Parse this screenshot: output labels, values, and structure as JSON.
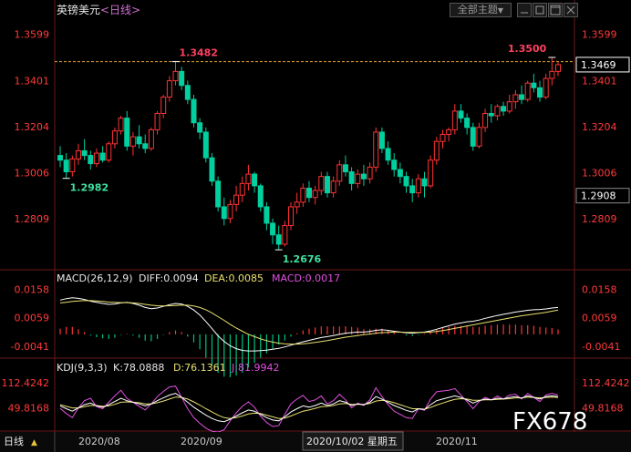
{
  "header": {
    "symbol": "英镑美元",
    "period": "<日线>",
    "topic_button": "全部主题",
    "topic_arrow": "▼"
  },
  "watermark": "FX678",
  "bottom_bar": {
    "period_label": "日线",
    "period_arrow": "▲",
    "dates": [
      "2020/08",
      "2020/09",
      "2020/10/02 星期五",
      "2020/11"
    ]
  },
  "chart_data": [
    {
      "type": "candlestick",
      "pane": "price",
      "y_ticks": [
        "1.3599",
        "1.3401",
        "1.3204",
        "1.3006",
        "1.2809"
      ],
      "ylim": [
        1.2614,
        1.366
      ],
      "current_price": "1.3469",
      "marker_price": "1.2908",
      "annotations": {
        "high1": "1.3482",
        "low1": "1.2982",
        "low2": "1.2676",
        "high2": "1.3500"
      },
      "reference_line": 1.3482,
      "ohlc": [
        [
          1.308,
          1.312,
          1.303,
          1.306
        ],
        [
          1.306,
          1.309,
          1.2982,
          1.301
        ],
        [
          1.301,
          1.308,
          1.299,
          1.3065
        ],
        [
          1.3065,
          1.313,
          1.304,
          1.31
        ],
        [
          1.31,
          1.315,
          1.306,
          1.308
        ],
        [
          1.308,
          1.31,
          1.302,
          1.3045
        ],
        [
          1.3045,
          1.311,
          1.303,
          1.309
        ],
        [
          1.309,
          1.312,
          1.305,
          1.306
        ],
        [
          1.306,
          1.314,
          1.305,
          1.313
        ],
        [
          1.313,
          1.32,
          1.311,
          1.3185
        ],
        [
          1.3185,
          1.325,
          1.317,
          1.324
        ],
        [
          1.324,
          1.327,
          1.31,
          1.312
        ],
        [
          1.312,
          1.318,
          1.308,
          1.316
        ],
        [
          1.316,
          1.321,
          1.311,
          1.313
        ],
        [
          1.313,
          1.317,
          1.309,
          1.311
        ],
        [
          1.311,
          1.32,
          1.31,
          1.319
        ],
        [
          1.319,
          1.327,
          1.317,
          1.326
        ],
        [
          1.326,
          1.334,
          1.324,
          1.333
        ],
        [
          1.333,
          1.342,
          1.331,
          1.34
        ],
        [
          1.34,
          1.3482,
          1.338,
          1.344
        ],
        [
          1.344,
          1.346,
          1.336,
          1.338
        ],
        [
          1.338,
          1.34,
          1.33,
          1.332
        ],
        [
          1.332,
          1.334,
          1.32,
          1.322
        ],
        [
          1.322,
          1.324,
          1.315,
          1.318
        ],
        [
          1.318,
          1.32,
          1.305,
          1.307
        ],
        [
          1.307,
          1.309,
          1.295,
          1.297
        ],
        [
          1.297,
          1.299,
          1.284,
          1.286
        ],
        [
          1.286,
          1.29,
          1.278,
          1.281
        ],
        [
          1.281,
          1.289,
          1.279,
          1.287
        ],
        [
          1.287,
          1.295,
          1.284,
          1.291
        ],
        [
          1.291,
          1.299,
          1.288,
          1.296
        ],
        [
          1.296,
          1.304,
          1.293,
          1.3
        ],
        [
          1.3,
          1.301,
          1.292,
          1.295
        ],
        [
          1.295,
          1.296,
          1.284,
          1.286
        ],
        [
          1.286,
          1.288,
          1.276,
          1.279
        ],
        [
          1.279,
          1.281,
          1.27,
          1.274
        ],
        [
          1.274,
          1.278,
          1.2676,
          1.27
        ],
        [
          1.27,
          1.28,
          1.269,
          1.278
        ],
        [
          1.278,
          1.288,
          1.276,
          1.286
        ],
        [
          1.286,
          1.292,
          1.283,
          1.288
        ],
        [
          1.288,
          1.296,
          1.286,
          1.294
        ],
        [
          1.294,
          1.297,
          1.288,
          1.29
        ],
        [
          1.29,
          1.295,
          1.287,
          1.293
        ],
        [
          1.293,
          1.301,
          1.291,
          1.299
        ],
        [
          1.299,
          1.301,
          1.29,
          1.292
        ],
        [
          1.292,
          1.299,
          1.29,
          1.297
        ],
        [
          1.297,
          1.306,
          1.295,
          1.304
        ],
        [
          1.304,
          1.308,
          1.299,
          1.301
        ],
        [
          1.301,
          1.303,
          1.293,
          1.296
        ],
        [
          1.296,
          1.302,
          1.294,
          1.3
        ],
        [
          1.3,
          1.304,
          1.295,
          1.298
        ],
        [
          1.298,
          1.305,
          1.296,
          1.303
        ],
        [
          1.303,
          1.32,
          1.301,
          1.318
        ],
        [
          1.318,
          1.32,
          1.309,
          1.311
        ],
        [
          1.311,
          1.314,
          1.304,
          1.306
        ],
        [
          1.306,
          1.309,
          1.299,
          1.302
        ],
        [
          1.302,
          1.305,
          1.296,
          1.299
        ],
        [
          1.299,
          1.301,
          1.292,
          1.295
        ],
        [
          1.295,
          1.298,
          1.288,
          1.292
        ],
        [
          1.292,
          1.3,
          1.29,
          1.298
        ],
        [
          1.298,
          1.301,
          1.29,
          1.295
        ],
        [
          1.295,
          1.308,
          1.294,
          1.306
        ],
        [
          1.306,
          1.316,
          1.304,
          1.314
        ],
        [
          1.314,
          1.319,
          1.311,
          1.317
        ],
        [
          1.317,
          1.32,
          1.314,
          1.319
        ],
        [
          1.319,
          1.33,
          1.317,
          1.327
        ],
        [
          1.327,
          1.33,
          1.322,
          1.324
        ],
        [
          1.324,
          1.326,
          1.317,
          1.32
        ],
        [
          1.32,
          1.322,
          1.31,
          1.312
        ],
        [
          1.312,
          1.322,
          1.311,
          1.32
        ],
        [
          1.32,
          1.328,
          1.318,
          1.326
        ],
        [
          1.326,
          1.33,
          1.322,
          1.325
        ],
        [
          1.325,
          1.33,
          1.323,
          1.329
        ],
        [
          1.329,
          1.331,
          1.325,
          1.327
        ],
        [
          1.327,
          1.334,
          1.326,
          1.331
        ],
        [
          1.331,
          1.336,
          1.328,
          1.334
        ],
        [
          1.334,
          1.338,
          1.33,
          1.332
        ],
        [
          1.332,
          1.34,
          1.331,
          1.339
        ],
        [
          1.339,
          1.343,
          1.335,
          1.337
        ],
        [
          1.337,
          1.34,
          1.331,
          1.333
        ],
        [
          1.333,
          1.343,
          1.332,
          1.341
        ],
        [
          1.341,
          1.35,
          1.338,
          1.344
        ],
        [
          1.344,
          1.348,
          1.342,
          1.3469
        ]
      ]
    },
    {
      "type": "macd",
      "pane": "macd",
      "label": "MACD(26,12,9)",
      "diff_label": "DIFF:0.0094",
      "dea_label": "DEA:0.0085",
      "macd_label": "MACD:0.0017",
      "y_ticks": [
        "0.0158",
        "0.0059",
        "-0.0041"
      ],
      "ylim": [
        -0.008,
        0.0175
      ],
      "diff": [
        0.012,
        0.0125,
        0.0128,
        0.0126,
        0.0122,
        0.0116,
        0.0112,
        0.0108,
        0.0105,
        0.0106,
        0.011,
        0.0112,
        0.0108,
        0.0102,
        0.0094,
        0.009,
        0.0092,
        0.0098,
        0.0104,
        0.0108,
        0.0106,
        0.0098,
        0.0085,
        0.0068,
        0.0045,
        0.002,
        -0.0005,
        -0.0025,
        -0.004,
        -0.005,
        -0.0056,
        -0.0058,
        -0.0058,
        -0.0057,
        -0.0055,
        -0.0052,
        -0.0049,
        -0.0044,
        -0.0038,
        -0.0032,
        -0.0026,
        -0.0021,
        -0.0016,
        -0.0011,
        -0.0008,
        -0.0004,
        0.0,
        0.0004,
        0.0006,
        0.0008,
        0.0008,
        0.001,
        0.0014,
        0.0016,
        0.0014,
        0.0011,
        0.0008,
        0.0005,
        0.0004,
        0.0006,
        0.0008,
        0.0012,
        0.0018,
        0.0024,
        0.003,
        0.0036,
        0.004,
        0.0044,
        0.0046,
        0.005,
        0.0056,
        0.0061,
        0.0066,
        0.007,
        0.0074,
        0.0078,
        0.0081,
        0.0084,
        0.0086,
        0.0087,
        0.0089,
        0.0092,
        0.0094
      ],
      "dea": [
        0.011,
        0.0112,
        0.0115,
        0.0117,
        0.0118,
        0.0118,
        0.0117,
        0.0115,
        0.0113,
        0.0112,
        0.0111,
        0.0111,
        0.011,
        0.0108,
        0.0105,
        0.0102,
        0.01,
        0.0099,
        0.01,
        0.0101,
        0.0102,
        0.0102,
        0.0099,
        0.0094,
        0.0086,
        0.0075,
        0.0062,
        0.0049,
        0.0035,
        0.0022,
        0.0011,
        0.0,
        -0.0008,
        -0.0016,
        -0.0022,
        -0.0027,
        -0.0031,
        -0.0033,
        -0.0034,
        -0.0034,
        -0.0033,
        -0.0031,
        -0.0028,
        -0.0025,
        -0.0022,
        -0.0018,
        -0.0014,
        -0.001,
        -0.0007,
        -0.0004,
        -0.0001,
        0.0001,
        0.0004,
        0.0006,
        0.0007,
        0.0008,
        0.0008,
        0.0007,
        0.0007,
        0.0007,
        0.0007,
        0.0008,
        0.001,
        0.0013,
        0.0017,
        0.0021,
        0.0025,
        0.0029,
        0.0033,
        0.0037,
        0.0041,
        0.0045,
        0.0049,
        0.0053,
        0.0057,
        0.0061,
        0.0065,
        0.0068,
        0.0071,
        0.0074,
        0.0077,
        0.0081,
        0.0085
      ],
      "hist": [
        0.002,
        0.0026,
        0.0026,
        0.0018,
        0.0008,
        -0.0004,
        -0.001,
        -0.0014,
        -0.0016,
        -0.0012,
        -0.0002,
        0.0002,
        -0.0004,
        -0.0012,
        -0.0022,
        -0.0024,
        -0.0016,
        -0.0002,
        0.0008,
        0.0014,
        0.0008,
        -0.0008,
        -0.0028,
        -0.0052,
        -0.0082,
        -0.011,
        -0.0134,
        -0.0148,
        -0.015,
        -0.0144,
        -0.0134,
        -0.0116,
        -0.01,
        -0.0082,
        -0.0066,
        -0.005,
        -0.0036,
        -0.0022,
        -0.0008,
        0.0004,
        0.0014,
        0.002,
        0.0024,
        0.0028,
        0.0028,
        0.0028,
        0.0028,
        0.0028,
        0.0026,
        0.0024,
        0.0018,
        0.0018,
        0.002,
        0.002,
        0.0014,
        0.0006,
        0.0,
        -0.0004,
        -0.0006,
        -0.0002,
        0.0002,
        0.0008,
        0.0016,
        0.0022,
        0.0026,
        0.003,
        0.003,
        0.003,
        0.0026,
        0.0026,
        0.003,
        0.0032,
        0.0034,
        0.0034,
        0.0034,
        0.0034,
        0.0032,
        0.0032,
        0.003,
        0.0026,
        0.0024,
        0.0022,
        0.0017
      ]
    },
    {
      "type": "kdj",
      "pane": "kdj",
      "label": "KDJ(9,3,3)",
      "k_label": "K:78.0888",
      "d_label": "D:76.1361",
      "j_label": "J:81.9942",
      "y_ticks": [
        "112.4242",
        "49.8168"
      ],
      "ylim": [
        -5,
        135
      ],
      "k": [
        55,
        48,
        42,
        50,
        58,
        62,
        55,
        52,
        58,
        66,
        74,
        68,
        64,
        60,
        55,
        60,
        68,
        75,
        82,
        86,
        76,
        64,
        52,
        42,
        32,
        24,
        18,
        16,
        22,
        30,
        38,
        45,
        42,
        34,
        26,
        20,
        18,
        28,
        40,
        48,
        55,
        52,
        56,
        62,
        56,
        60,
        68,
        64,
        56,
        60,
        58,
        64,
        78,
        72,
        64,
        56,
        50,
        44,
        40,
        48,
        46,
        58,
        68,
        72,
        76,
        80,
        76,
        70,
        62,
        68,
        72,
        70,
        74,
        72,
        76,
        78,
        74,
        80,
        76,
        72,
        78,
        80,
        78
      ],
      "d": [
        58,
        54,
        50,
        50,
        53,
        56,
        56,
        54,
        55,
        59,
        64,
        65,
        64,
        63,
        60,
        60,
        63,
        67,
        72,
        77,
        76,
        72,
        65,
        57,
        48,
        40,
        32,
        26,
        24,
        26,
        30,
        35,
        37,
        36,
        32,
        28,
        24,
        25,
        30,
        36,
        42,
        45,
        49,
        53,
        54,
        56,
        60,
        61,
        59,
        59,
        59,
        61,
        67,
        69,
        67,
        63,
        58,
        53,
        48,
        48,
        47,
        51,
        57,
        62,
        67,
        71,
        73,
        72,
        69,
        69,
        70,
        70,
        71,
        72,
        73,
        75,
        75,
        77,
        76,
        75,
        76,
        77,
        76
      ],
      "j": [
        49,
        36,
        26,
        50,
        68,
        74,
        53,
        48,
        64,
        80,
        94,
        74,
        64,
        54,
        45,
        60,
        78,
        91,
        102,
        104,
        76,
        48,
        26,
        12,
        0,
        -8,
        -10,
        -4,
        18,
        38,
        54,
        65,
        52,
        30,
        14,
        4,
        6,
        34,
        60,
        72,
        81,
        66,
        70,
        80,
        60,
        68,
        84,
        70,
        50,
        62,
        56,
        70,
        100,
        78,
        58,
        42,
        34,
        26,
        24,
        48,
        44,
        72,
        90,
        92,
        94,
        98,
        82,
        66,
        48,
        66,
        76,
        70,
        80,
        72,
        82,
        84,
        72,
        86,
        76,
        66,
        82,
        86,
        82
      ]
    }
  ]
}
